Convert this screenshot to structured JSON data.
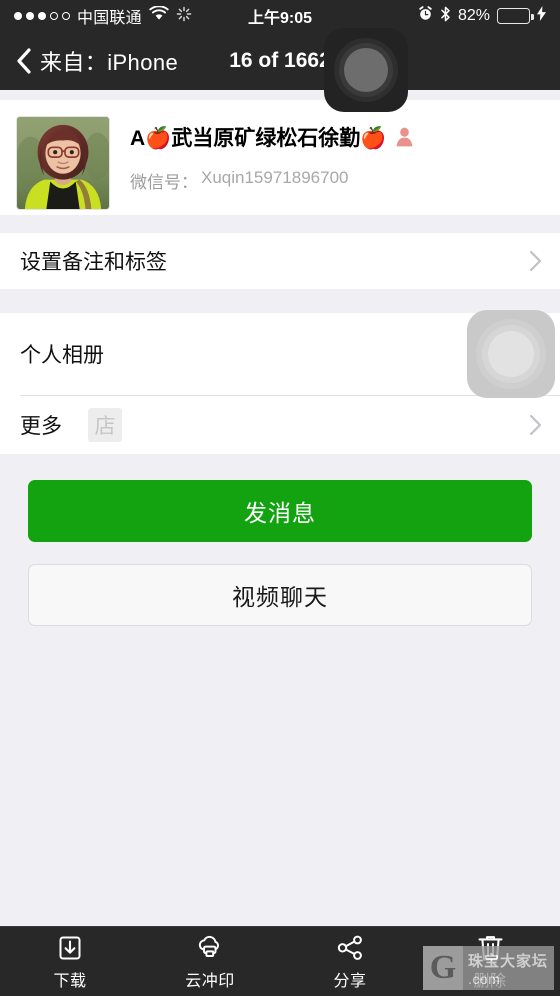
{
  "status_bar": {
    "signal_dots_filled": 3,
    "signal_dots_total": 5,
    "carrier": "中国联通",
    "wifi_icon": "wifi-icon",
    "activity_icon": "activity-spinner-icon",
    "time": "上午9:05",
    "alarm_icon": "alarm-clock-icon",
    "bluetooth_icon": "bluetooth-icon",
    "battery_percent": "82%",
    "battery_level": 82,
    "battery_color": "#3ED13B",
    "charging_icon": "lightning-bolt-icon"
  },
  "nav_bar": {
    "back_icon": "chevron-left-icon",
    "back_label": "来自：iPhone",
    "title": "16 of 1662",
    "overlay_puck": "home-button-overlay-icon"
  },
  "profile": {
    "avatar_alt": "user-avatar-photo",
    "display_name": "A🍎武当原矿绿松石徐勤🍎",
    "gender_icon": "female-silhouette-icon",
    "wechat_id_label": "微信号：",
    "wechat_id_value": "Xuqin15971896700"
  },
  "rows": [
    {
      "label": "设置备注和标签",
      "badge": null,
      "chevron": "chevron-right-icon"
    },
    {
      "label": "个人相册",
      "badge": null,
      "chevron": "chevron-right-icon",
      "overlay_puck": "touch-indicator-overlay-icon"
    },
    {
      "label": "更多",
      "badge": "店",
      "chevron": "chevron-right-icon"
    }
  ],
  "buttons": {
    "primary_label": "发消息",
    "primary_color": "#13A311",
    "secondary_label": "视频聊天"
  },
  "toolbar": {
    "items": [
      {
        "label": "下载",
        "icon": "download-icon"
      },
      {
        "label": "云冲印",
        "icon": "cloud-print-icon"
      },
      {
        "label": "分享",
        "icon": "share-icon"
      },
      {
        "label": "删除",
        "icon": "trash-icon"
      }
    ]
  },
  "watermark": {
    "logo_letter": "G",
    "line1": "珠宝大家坛",
    "line2": ".com"
  }
}
